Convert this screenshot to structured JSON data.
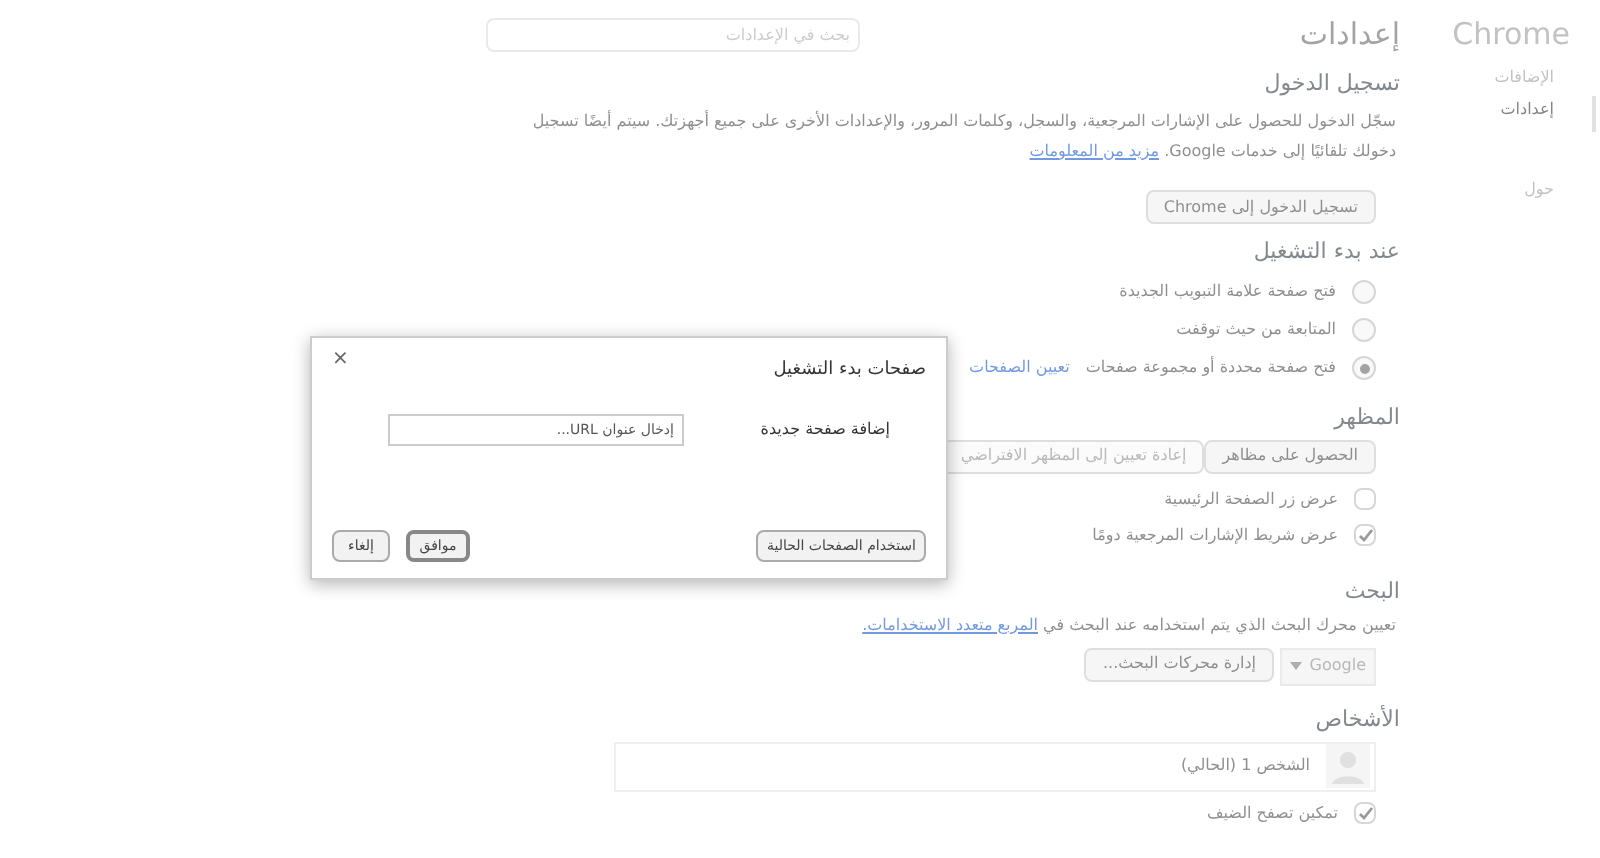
{
  "sidebar": {
    "title": "Chrome",
    "items": [
      {
        "label": "الإضافات",
        "selected": false
      },
      {
        "label": "إعدادات",
        "selected": true
      },
      {
        "label": "حول",
        "selected": false
      }
    ]
  },
  "header": {
    "title": "إعدادات",
    "search": {
      "placeholder": "بحث في الإعدادات"
    }
  },
  "sign_in": {
    "heading": "تسجيل الدخول",
    "text": "سجّل الدخول للحصول على الإشارات المرجعية، والسجل، وكلمات المرور، والإعدادات الأخرى على جميع أجهزتك. سيتم أيضًا تسجيل دخولك تلقائيًا إلى خدمات Google.",
    "link": "مزيد من المعلومات",
    "button": "تسجيل الدخول إلى Chrome"
  },
  "startup": {
    "heading": "عند بدء التشغيل",
    "options": [
      {
        "label": "فتح صفحة علامة التبويب الجديدة",
        "selected": false
      },
      {
        "label": "المتابعة من حيث توقفت",
        "selected": false
      },
      {
        "label": "فتح صفحة محددة أو مجموعة صفحات",
        "link": "تعيين الصفحات",
        "selected": true
      }
    ]
  },
  "appearance": {
    "heading": "المظهر",
    "buttons": [
      {
        "label": "الحصول على مظاهر",
        "disabled": false
      },
      {
        "label": "إعادة تعيين إلى المظهر الافتراضي",
        "disabled": true
      }
    ],
    "checkboxes": [
      {
        "label": "عرض زر الصفحة الرئيسية",
        "checked": false
      },
      {
        "label": "عرض شريط الإشارات المرجعية دومًا",
        "checked": true
      }
    ]
  },
  "search": {
    "heading": "البحث",
    "text": "تعيين محرك البحث الذي يتم استخدامه عند البحث في",
    "link": "المربع متعدد الاستخدامات.",
    "engine": "Google",
    "button": "إدارة محركات البحث..."
  },
  "people": {
    "heading": "الأشخاص",
    "profile": "الشخص 1 (الحالي)",
    "checkboxes": [
      {
        "label": "تمكين تصفح الضيف",
        "checked": true
      }
    ]
  },
  "dialog": {
    "title": "صفحات بدء التشغيل",
    "close": "×",
    "field_label": "إضافة صفحة جديدة",
    "placeholder": "إدخال عنوان URL...",
    "use_current": "استخدام الصفحات الحالية",
    "ok": "موافق",
    "cancel": "إلغاء"
  }
}
